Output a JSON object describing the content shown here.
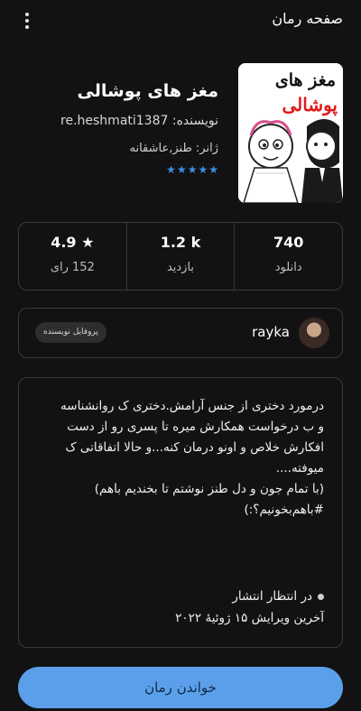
{
  "header": {
    "title": "صفحه رمان",
    "menu_icon": "more-vertical-icon"
  },
  "book": {
    "cover_text_line1": "مغز های",
    "cover_text_line2": "پوشالی",
    "title": "مغز های پوشالی",
    "author_line": "نویسنده: re.heshmati1387",
    "genre_line": "ژانر: طنز,عاشقانه",
    "star_count": 5,
    "star_color": "#3d8fe3"
  },
  "stats": {
    "rating_value": "4.9 ★",
    "rating_label": "152 رای",
    "views_value": "1.2 k",
    "views_label": "بازدید",
    "downloads_value": "740",
    "downloads_label": "دانلود"
  },
  "author": {
    "name": "rayka",
    "profile_button": "پروفایل نویسنده"
  },
  "description": {
    "text": "درمورد دختری از جنس آرامش.دختری ک روانشناسه\nو ب درخواست همکارش میره تا پسری رو از دست\nافکارش خلاص و اونو درمان کنه...و حالا اتفاقاتی ک\nمیوفته....\n(با تمام جون و دل طنز نوشتم تا بخندیم باهم)\n#باهم‌بخونیم؟:)",
    "status": "در انتظار انتشار",
    "last_updated": "آخرین ویرایش ۱۵ ژوئیهٔ ۲۰۲۲"
  },
  "actions": {
    "read_button": "خواندن رمان"
  },
  "colors": {
    "background": "#121212",
    "accent": "#5b9fea",
    "card_border": "#3a3a3a"
  }
}
